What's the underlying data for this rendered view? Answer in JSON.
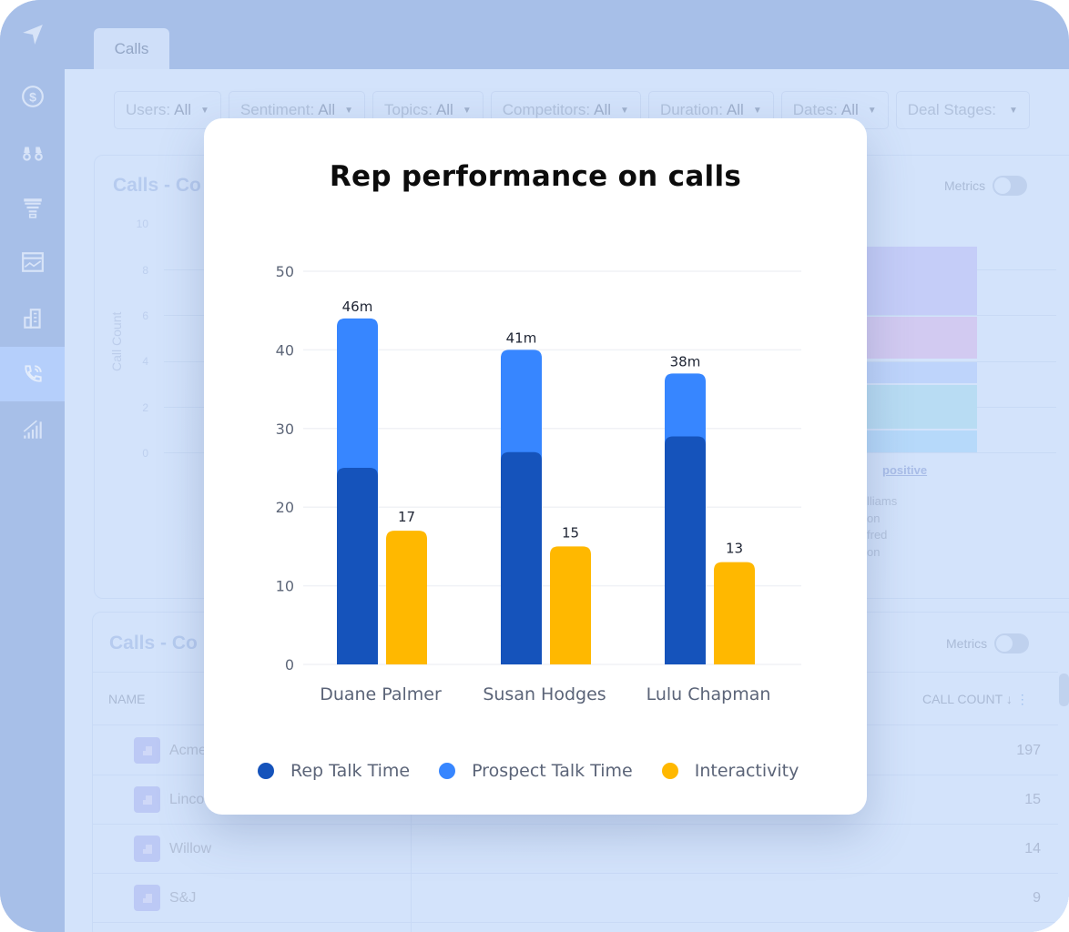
{
  "app": {
    "tab_label": "Calls",
    "sidebar_icons": [
      "send-icon",
      "dollar-icon",
      "binoculars-icon",
      "funnel-icon",
      "chart-window-icon",
      "building-icon",
      "phone-call-icon",
      "signal-bars-icon"
    ],
    "active_sidebar_index": 6
  },
  "filters": [
    {
      "label": "Users:",
      "value": "All"
    },
    {
      "label": "Sentiment:",
      "value": "All"
    },
    {
      "label": "Topics:",
      "value": "All"
    },
    {
      "label": "Competitors:",
      "value": "All"
    },
    {
      "label": "Duration:",
      "value": "All"
    },
    {
      "label": "Dates:",
      "value": "All"
    },
    {
      "label": "Deal Stages:",
      "value": ""
    }
  ],
  "bg_card1": {
    "title": "Calls - Co",
    "metrics_label": "Metrics",
    "y_label": "Call Count",
    "y_ticks": [
      "10",
      "8",
      "6",
      "4",
      "2",
      "0"
    ],
    "positive_label": "positive",
    "names": [
      "lliams",
      "on",
      "fred",
      "on"
    ]
  },
  "bg_card2": {
    "title": "Calls - Co",
    "metrics_label": "Metrics",
    "col_name": "NAME",
    "col_count": "CALL COUNT",
    "rows": [
      {
        "name": "Acme",
        "count": "197"
      },
      {
        "name": "Linco",
        "count": "15"
      },
      {
        "name": "Willow",
        "count": "14"
      },
      {
        "name": "S&J",
        "count": "9"
      }
    ]
  },
  "chart_data": {
    "type": "bar",
    "title": "Rep performance on calls",
    "categories": [
      "Duane Palmer",
      "Susan Hodges",
      "Lulu Chapman"
    ],
    "ylim": [
      0,
      50
    ],
    "y_ticks": [
      0,
      10,
      20,
      30,
      40,
      50
    ],
    "grid": true,
    "legend_position": "bottom",
    "series": [
      {
        "name": "Rep Talk Time",
        "color": "#1553bb",
        "values": [
          25,
          27,
          29
        ],
        "stack": "talk"
      },
      {
        "name": "Prospect Talk Time",
        "color": "#3786ff",
        "values": [
          19,
          13,
          8
        ],
        "stack": "talk"
      },
      {
        "name": "Interactivity",
        "color": "#ffb800",
        "values": [
          17,
          15,
          13
        ],
        "stack": "inter"
      }
    ],
    "total_labels": [
      "46m",
      "41m",
      "38m"
    ],
    "interactivity_labels": [
      "17",
      "15",
      "13"
    ]
  }
}
